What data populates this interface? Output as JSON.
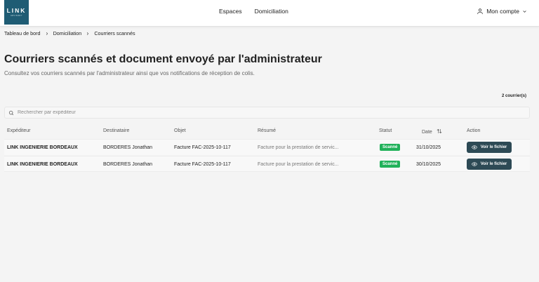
{
  "header": {
    "logo_text": "LINK",
    "logo_subtext": "ADVISORY",
    "nav": [
      {
        "label": "Espaces"
      },
      {
        "label": "Domiciliation"
      }
    ],
    "account_label": "Mon compte"
  },
  "breadcrumb": [
    "Tableau de bord",
    "Domiciliation",
    "Courriers scannés"
  ],
  "page": {
    "title": "Courriers scannés et document envoyé par l'administrateur",
    "subtitle": "Consultez vos courriers scannés par l'administrateur ainsi que vos notifications de réception de colis.",
    "count": "2 courrier(s)"
  },
  "search": {
    "placeholder": "Rechercher par expéditeur",
    "value": ""
  },
  "table": {
    "columns": [
      "Expéditeur",
      "Destinataire",
      "Objet",
      "Résumé",
      "Statut",
      "Date",
      "Action"
    ],
    "rows": [
      {
        "expediteur": "LINK INGENIERIE BORDEAUX",
        "destinataire": "BORDERES Jonathan",
        "objet": "Facture FAC-2025-10-117",
        "resume": "Facture pour la prestation de servic...",
        "statut": "Scanné",
        "date": "31/10/2025",
        "action": "Voir le fichier"
      },
      {
        "expediteur": "LINK INGENIERIE BORDEAUX",
        "destinataire": "BORDERES Jonathan",
        "objet": "Facture FAC-2025-10-117",
        "resume": "Facture pour la prestation de servic...",
        "statut": "Scanné",
        "date": "30/10/2025",
        "action": "Voir le fichier"
      }
    ]
  },
  "colors": {
    "brand": "#1f5c74",
    "status_scanned": "#21b15a",
    "button": "#2d4a55"
  },
  "icons": {
    "account": "user-icon",
    "account_dropdown": "chevron-down-icon",
    "breadcrumb_separator": "chevron-right-icon",
    "search": "search-icon",
    "sort": "sort-icon",
    "view": "eye-icon"
  }
}
